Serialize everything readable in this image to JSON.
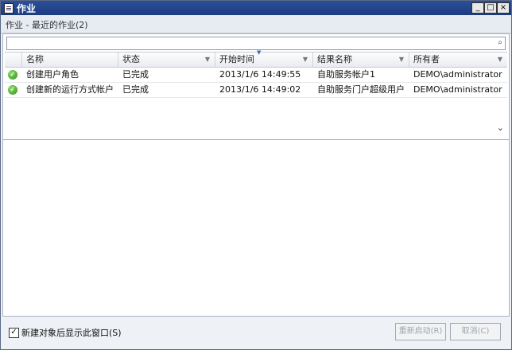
{
  "window": {
    "title": "作业"
  },
  "controls": {
    "minimize": "_",
    "maximize": "□",
    "close": "×"
  },
  "subheader": {
    "text": "作业 - 最近的作业(2)"
  },
  "search": {
    "value": "",
    "placeholder": ""
  },
  "table": {
    "headers": [
      "名称",
      "状态",
      "开始时间",
      "结果名称",
      "所有者"
    ],
    "rows": [
      {
        "name": "创建用户角色",
        "status": "已完成",
        "start": "2013/1/6 14:49:55",
        "result": "自助服务帐户1",
        "owner": "DEMO\\administrator"
      },
      {
        "name": "创建新的运行方式帐户",
        "status": "已完成",
        "start": "2013/1/6 14:49:02",
        "result": "自助服务门户超级用户",
        "owner": "DEMO\\administrator"
      }
    ]
  },
  "footer": {
    "checkbox_label": "新建对象后显示此窗口(S)",
    "checked": true,
    "restart_label": "重新启动(R)",
    "cancel_label": "取消(C)"
  }
}
